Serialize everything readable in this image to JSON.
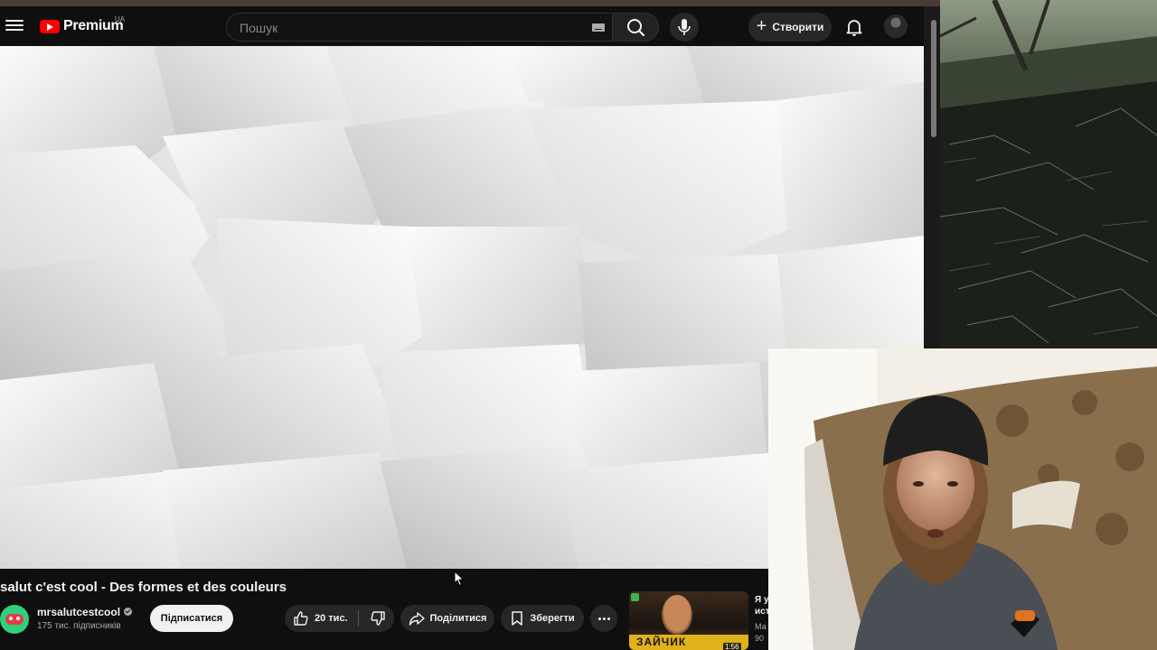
{
  "header": {
    "logo_text": "Premium",
    "region": "UA",
    "search_placeholder": "Пошук",
    "create_label": "Створити"
  },
  "video": {
    "title": "salut c'est cool - Des formes et des couleurs",
    "channel": {
      "name": "mrsalutcestcool",
      "subscribers": "175 тис. підписників",
      "verified": true
    },
    "actions": {
      "subscribe": "Підписатися",
      "likes": "20 тис.",
      "share": "Поділитися",
      "save": "Зберегти"
    }
  },
  "recommendation": {
    "thumb_text": "ЗАЙЧИК",
    "duration": "1:56",
    "title_lines": [
      "Я у",
      "ист"
    ],
    "meta_lines": [
      "Ма",
      "90"
    ]
  },
  "icons": {
    "menu": "hamburger-icon",
    "search": "search-icon",
    "mic": "mic-icon",
    "create": "plus-icon",
    "notifications": "bell-icon",
    "like": "thumbs-up-icon",
    "dislike": "thumbs-down-icon",
    "share": "share-icon",
    "save": "bookmark-icon",
    "more": "more-horizontal-icon"
  },
  "colors": {
    "background": "#0f0f0f",
    "brand_red": "#ff0000",
    "button_bg": "#272727",
    "subscribe_bg": "#f1f1f1"
  }
}
